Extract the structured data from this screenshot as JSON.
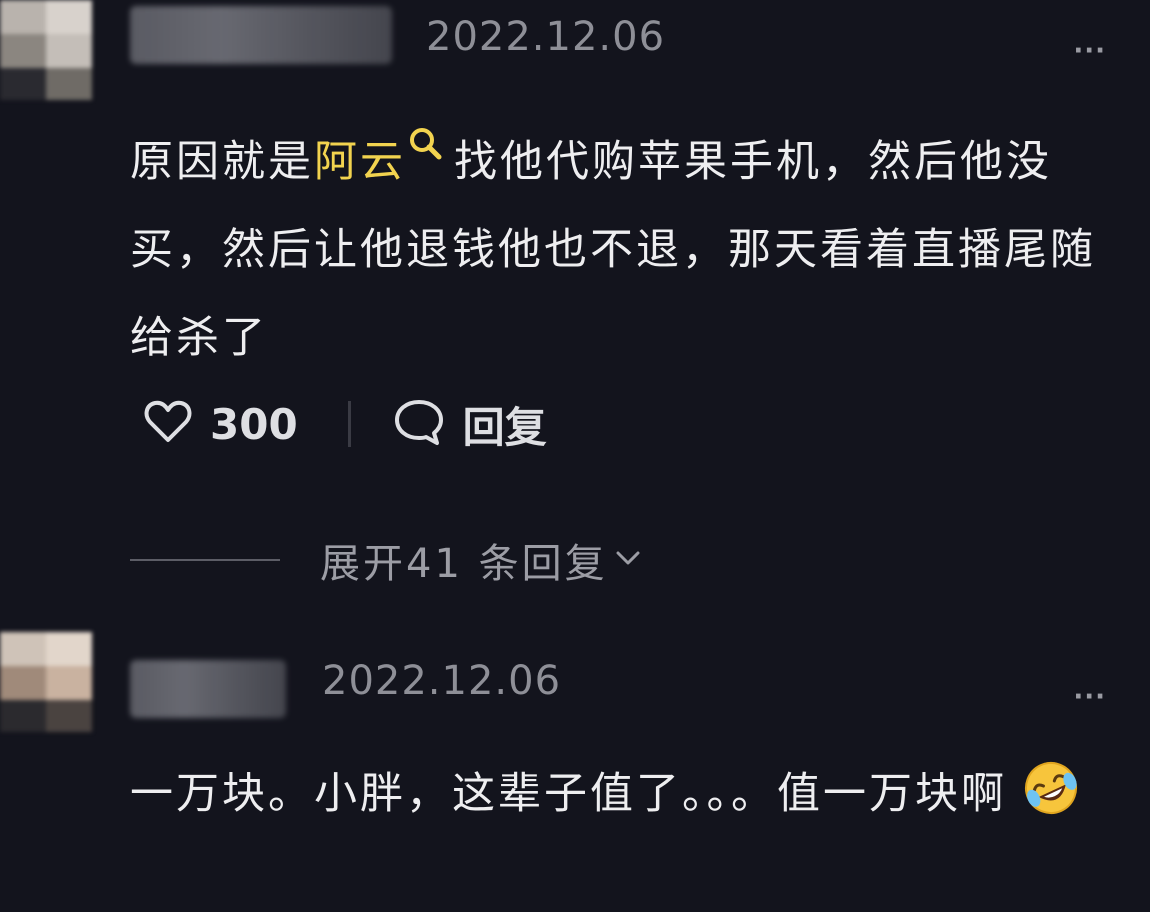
{
  "comments": [
    {
      "date": "2022.12.06",
      "more_label": "···",
      "text": {
        "before": "原因就是",
        "keyword": "阿云",
        "after": "找他代购苹果手机，然后他没买，然后让他退钱他也不退，那天看着直播尾随给杀了"
      },
      "likes": "300",
      "reply_label": "回复",
      "expand_label": "展开41 条回复"
    },
    {
      "date": "2022.12.06",
      "more_label": "···",
      "text": {
        "main": "一万块。小胖，这辈子值了。。。值一万块啊",
        "emoji": "rolling-on-floor-laughing"
      }
    }
  ],
  "icons": {
    "heart": "heart-icon",
    "reply": "speech-bubble-icon",
    "chevron": "chevron-down-icon",
    "search": "search-icon",
    "emoji": "laughing-crying-emoji"
  },
  "colors": {
    "background": "#13141d",
    "keyword": "#f2d34f",
    "text": "#eeeef0",
    "muted": "#8e8f97"
  }
}
